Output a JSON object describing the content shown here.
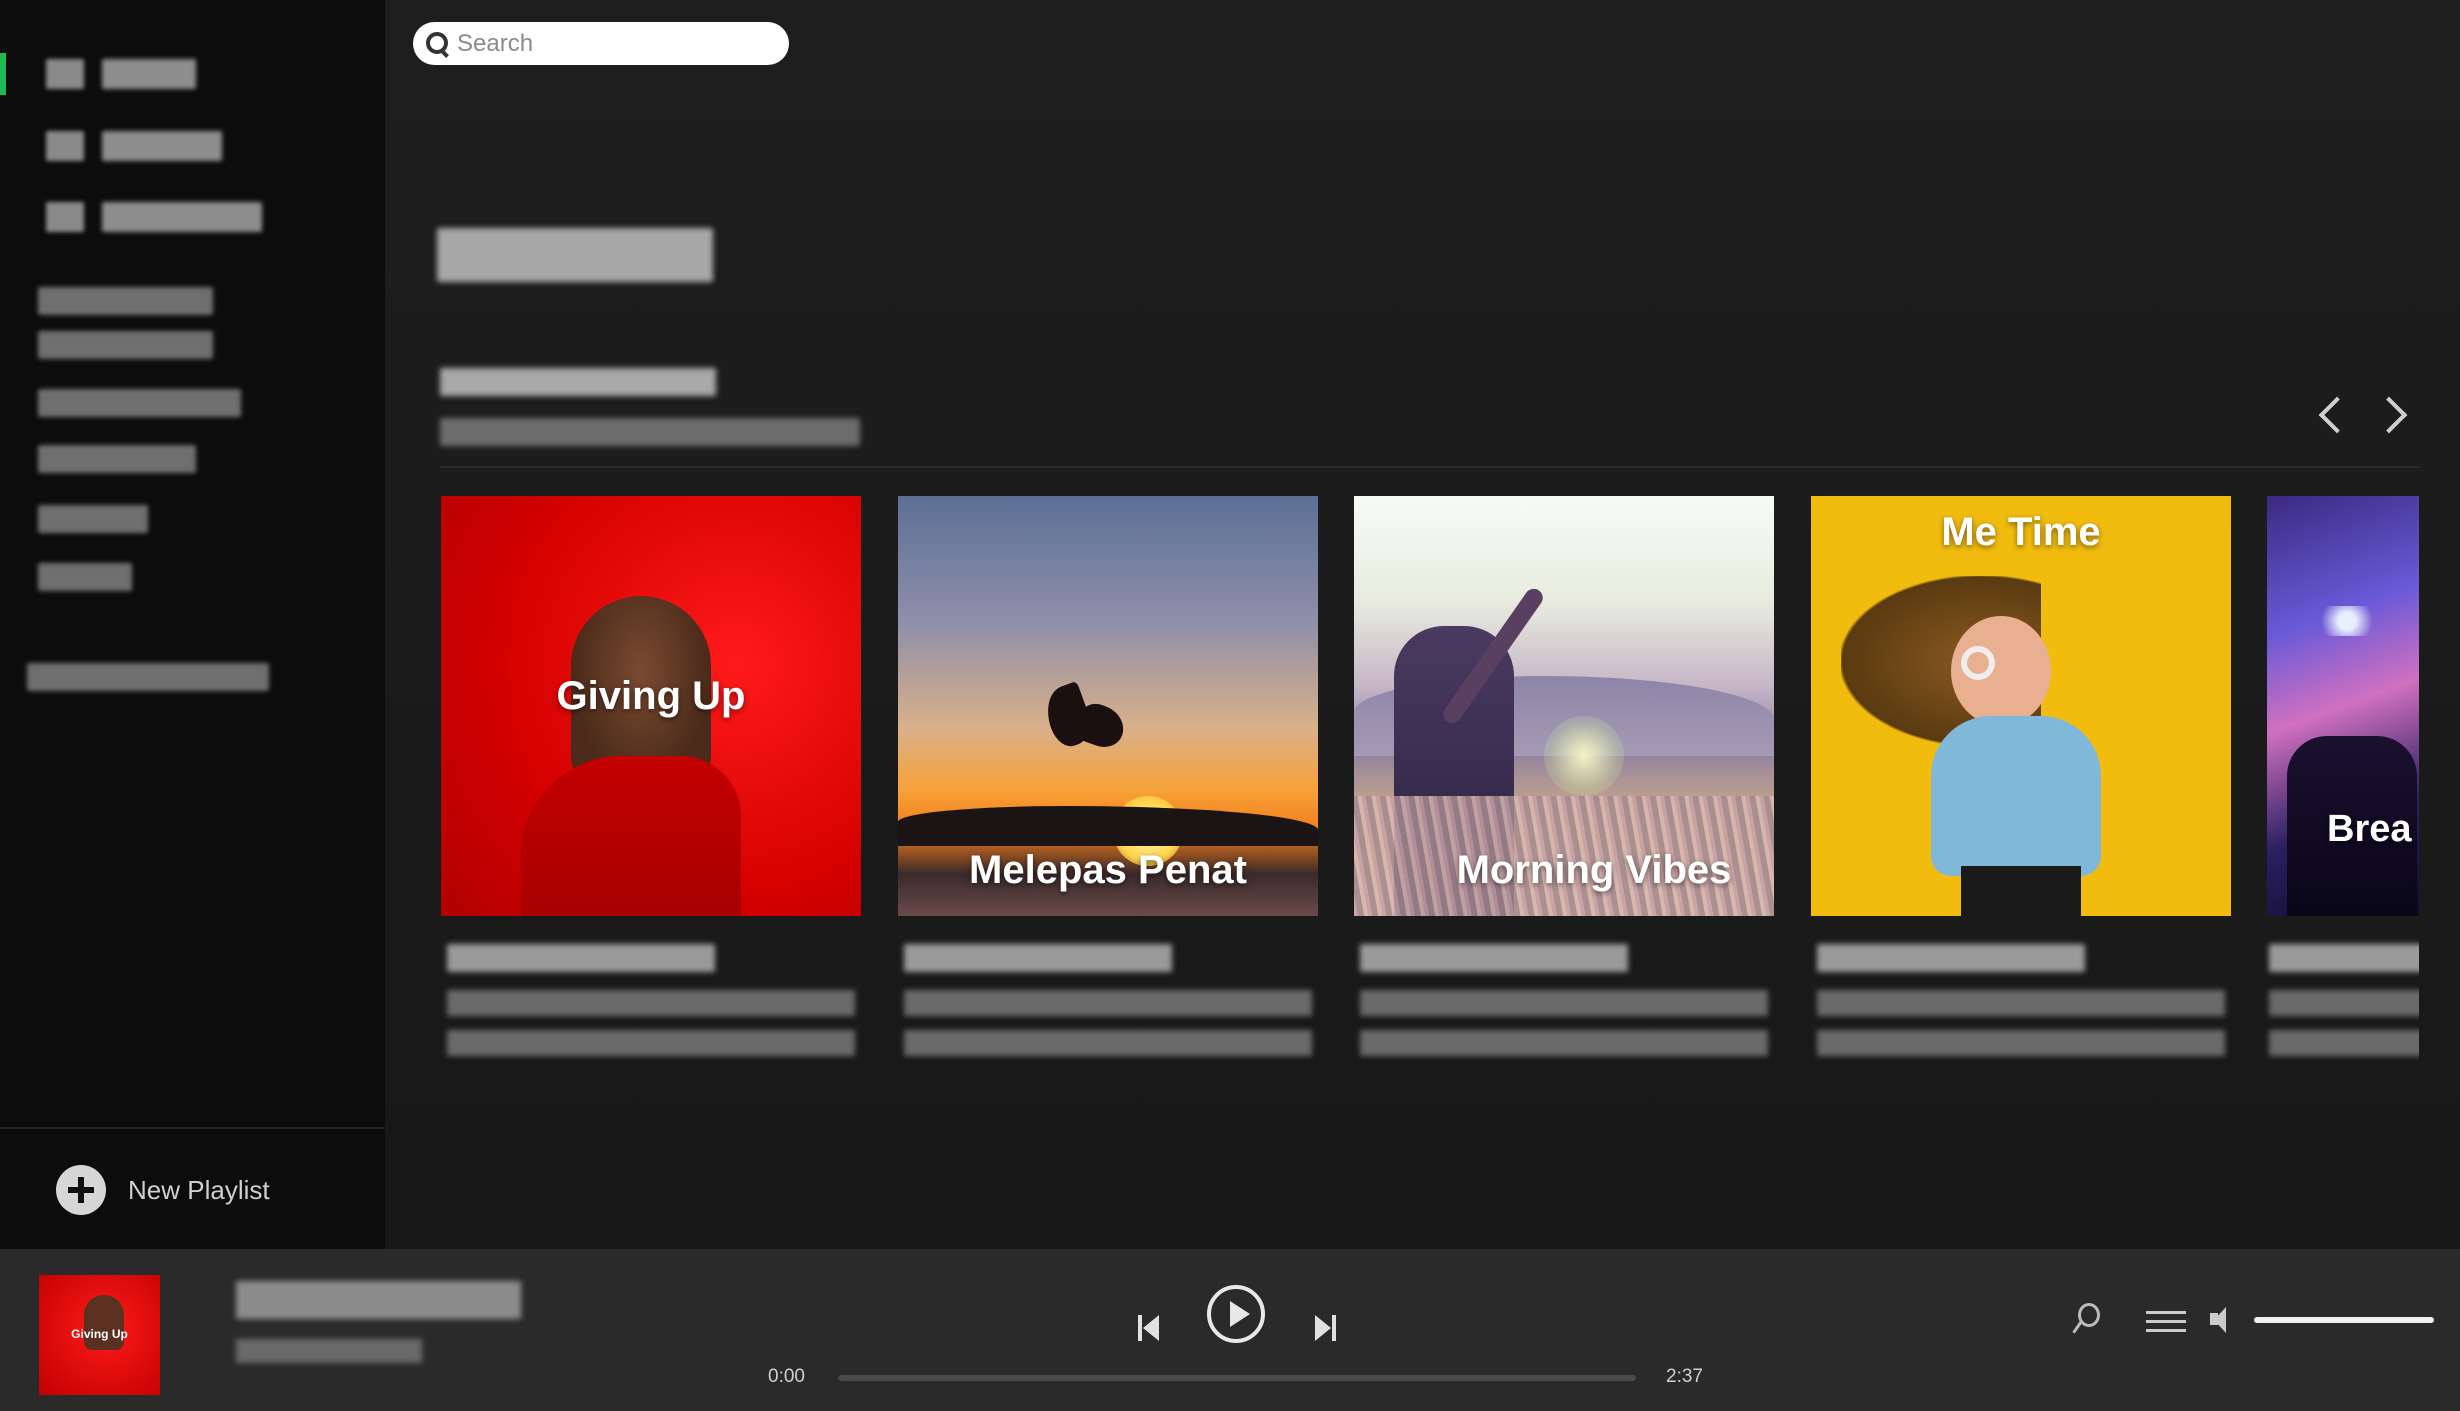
{
  "search": {
    "placeholder": "Search"
  },
  "sidebar": {
    "new_playlist_label": "New Playlist"
  },
  "carousel": {
    "cards": [
      {
        "cover_title": "Giving Up"
      },
      {
        "cover_title": "Melepas Penat"
      },
      {
        "cover_title": "Morning Vibes"
      },
      {
        "cover_title": "Me Time"
      },
      {
        "cover_title": "Brea"
      }
    ]
  },
  "player": {
    "thumb_title": "Giving Up",
    "current_time": "0:00",
    "total_time": "2:37",
    "progress_fraction": 0.0,
    "volume_fraction": 1.0
  },
  "colors": {
    "accent": "#1db954",
    "sidebar_bg": "#0c0c0c",
    "main_bg": "#181818",
    "player_bg": "#2a2a2a"
  },
  "icons": [
    "search-icon",
    "plus-circle-icon",
    "chevron-left-icon",
    "chevron-right-icon",
    "previous-icon",
    "play-icon",
    "next-icon",
    "lyrics-mic-icon",
    "queue-icon",
    "volume-icon"
  ]
}
